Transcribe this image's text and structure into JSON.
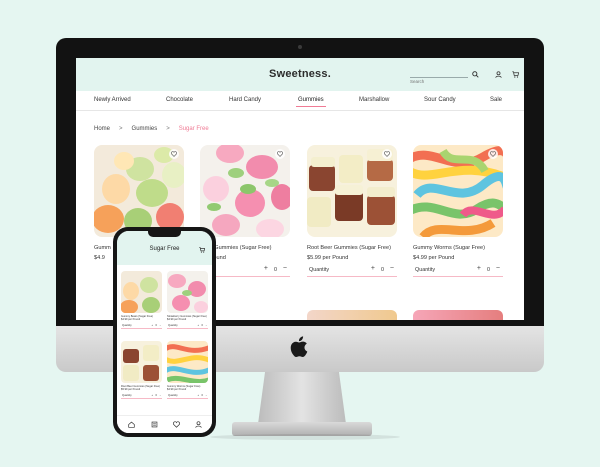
{
  "site": {
    "brand": "Sweetness.",
    "search_placeholder": "Search"
  },
  "nav": [
    {
      "label": "Newly Arrived",
      "active": false
    },
    {
      "label": "Chocolate",
      "active": false
    },
    {
      "label": "Hard Candy",
      "active": false
    },
    {
      "label": "Gummies",
      "active": true
    },
    {
      "label": "Marshallow",
      "active": false
    },
    {
      "label": "Sour Candy",
      "active": false
    },
    {
      "label": "Sale",
      "active": false
    }
  ],
  "breadcrumb": {
    "items": [
      "Home",
      "Gummies",
      "Sugar Free"
    ],
    "separator": ">"
  },
  "products": [
    {
      "name": "Gummy Bears (Sugar Free)",
      "price": "$4.99 per Pound",
      "quantity_label": "Quantity",
      "quantity": "0",
      "image": "gummy-bears"
    },
    {
      "name": "Strawberry Gummies (Sugar Free)",
      "price": "$4.99 per Pound",
      "quantity_label": "Quantity",
      "quantity": "0",
      "image": "strawberry-gummies"
    },
    {
      "name": "Root Beer Gummies (Sugar Free)",
      "price": "$5.99 per Pound",
      "quantity_label": "Quantity",
      "quantity": "0",
      "image": "root-beer-gummies"
    },
    {
      "name": "Gummy Worms (Sugar Free)",
      "price": "$4.99 per Pound",
      "quantity_label": "Quantity",
      "quantity": "0",
      "image": "gummy-worms"
    }
  ],
  "desktop_visible": {
    "card1_name": "Gumm",
    "card1_price": "$4.9",
    "card2_name": "berry Gummies (Sugar Free)",
    "card2_price": "per Pound"
  },
  "mobile": {
    "title": "Sugar Free",
    "products": [
      {
        "name": "Gummy Bears (Sugar Free)",
        "price": "$4.99 per Pound",
        "quantity_label": "Quantity",
        "quantity": "0"
      },
      {
        "name": "Strawberry Gummies (Sugar Free)",
        "price": "$4.99 per Pound",
        "quantity_label": "Quantity",
        "quantity": "0"
      },
      {
        "name": "Root Beer Gummies (Sugar Free)",
        "price": "$5.99 per Pound",
        "quantity_label": "Quantity",
        "quantity": "0"
      },
      {
        "name": "Gummy Worms (Sugar Free)",
        "price": "$4.99 per Pound",
        "quantity_label": "Quantity",
        "quantity": "0"
      }
    ],
    "tabbar_icons": [
      "home-icon",
      "menu-icon",
      "heart-icon",
      "user-icon"
    ]
  },
  "icons": {
    "search": "search-icon",
    "account": "user-icon",
    "cart": "cart-icon",
    "favorite": "heart-icon"
  },
  "colors": {
    "page_background": "#e5f6f1",
    "header_mint": "#e2f4ef",
    "accent_pink": "#f07b95",
    "quantity_underline": "#f6b9c6"
  }
}
